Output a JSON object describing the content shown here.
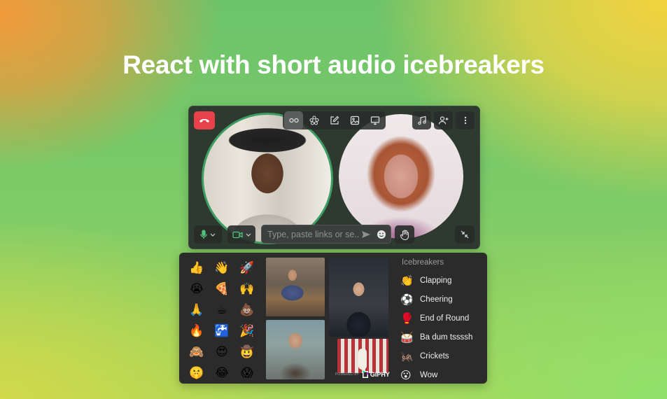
{
  "headline": "React with short audio icebreakers",
  "call": {
    "chat_placeholder": "Type, paste links or se...",
    "toolbar_icons": [
      "layout-icon",
      "effects-icon",
      "whiteboard-icon",
      "image-icon",
      "screen-share-icon"
    ],
    "right_icons": [
      "music-icon",
      "add-person-icon",
      "more-icon"
    ]
  },
  "emojis": [
    "👍",
    "👋",
    "🚀",
    "😭",
    "🍕",
    "🙌",
    "🙏",
    "☕",
    "💩",
    "🔥",
    "🚰",
    "🎉",
    "🙈",
    "😍",
    "🤠",
    "🤫",
    "😂",
    "😱"
  ],
  "gifs": {
    "attribution_label": "POWERED BY",
    "brand": "GIPHY"
  },
  "icebreakers": {
    "title": "Icebreakers",
    "items": [
      {
        "icon": "👏",
        "label": "Clapping"
      },
      {
        "icon": "⚽",
        "label": "Cheering"
      },
      {
        "icon": "🥊",
        "label": "End of Round"
      },
      {
        "icon": "🥁",
        "label": "Ba dum tssssh"
      },
      {
        "icon": "🦗",
        "label": "Crickets"
      },
      {
        "icon": "😮",
        "label": "Wow"
      }
    ]
  },
  "colors": {
    "hangup": "#e8414b",
    "accent_green": "#3d9e63",
    "panel_bg": "#2b2b2b"
  }
}
